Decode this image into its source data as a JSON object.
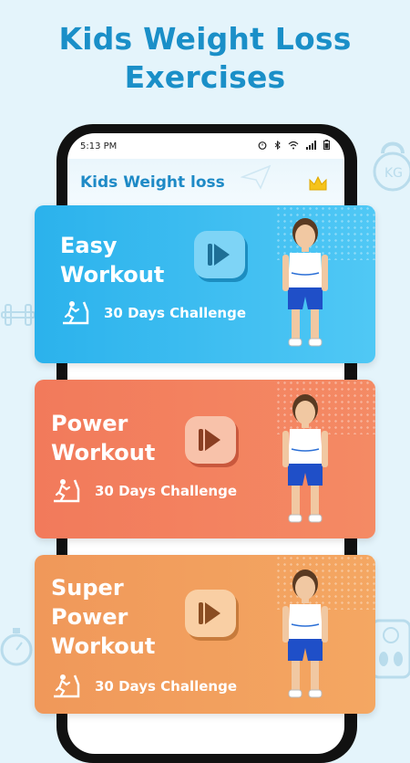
{
  "headline": {
    "line1": "Kids Weight Loss",
    "line2": "Exercises"
  },
  "status_bar": {
    "time": "5:13 PM"
  },
  "app_bar": {
    "title": "Kids Weight loss"
  },
  "cards": [
    {
      "title_line1": "Easy",
      "title_line2": "Workout",
      "challenge": "30 Days Challenge"
    },
    {
      "title_line1": "Power",
      "title_line2": "Workout",
      "challenge": "30 Days Challenge"
    },
    {
      "title_line1": "Super",
      "title_line2": "Power",
      "title_line3": "Workout",
      "challenge": "30 Days Challenge"
    }
  ],
  "colors": {
    "headline": "#1a8fc8",
    "easy_card": "#33b8f0",
    "power_card": "#f3815f",
    "super_card": "#f0a15c"
  }
}
